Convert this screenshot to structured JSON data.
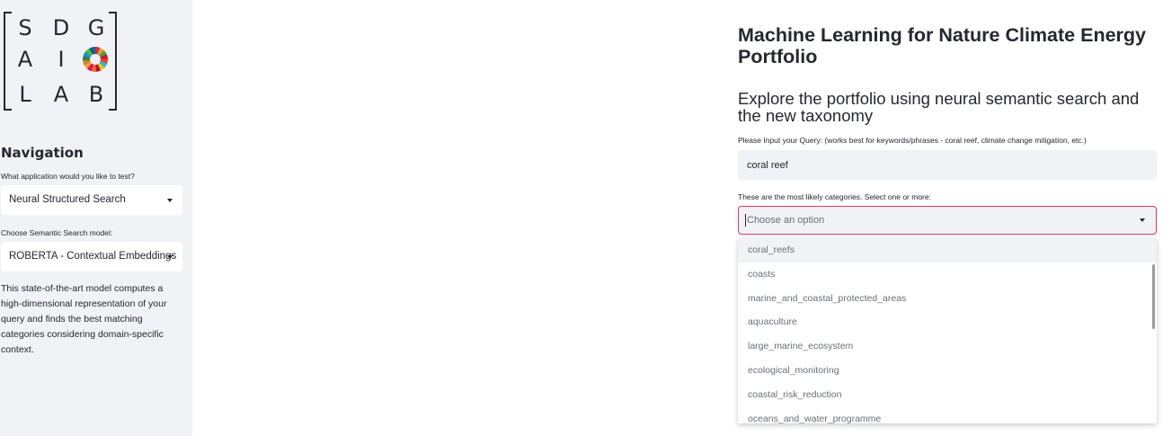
{
  "sidebar": {
    "logo": {
      "letters": [
        "S",
        "D",
        "G",
        "A",
        "I",
        "L",
        "A",
        "B"
      ],
      "wheel": "sdg-color-wheel-icon"
    },
    "nav_title": "Navigation",
    "app_label": "What application would you like to test?",
    "app_value": "Neural Structured Search",
    "model_label": "Choose Semantic Search model:",
    "model_value": "ROBERTA - Contextual Embeddings",
    "description": "This state-of-the-art model computes a high-dimensional representation of your query and finds the best matching categories considering domain-specific context."
  },
  "main": {
    "title": "Machine Learning for Nature Climate Energy Portfolio",
    "subtitle": "Explore the portfolio using neural semantic search and the new taxonomy",
    "query_label": "Please Input your Query: (works best for keywords/phrases - coral reef, climate change mitigation, etc.)",
    "query_value": "coral reef",
    "categories_label": "These are the most likely categories. Select one or more:",
    "categories_placeholder": "Choose an option",
    "options": [
      "coral_reefs",
      "coasts",
      "marine_and_coastal_protected_areas",
      "aquaculture",
      "large_marine_ecosystem",
      "ecological_monitoring",
      "coastal_risk_reduction",
      "oceans_and_water_programme"
    ]
  },
  "colors": {
    "sidebar_bg": "#f0f2f6",
    "focus_border": "#e0385a",
    "text": "#262730"
  }
}
